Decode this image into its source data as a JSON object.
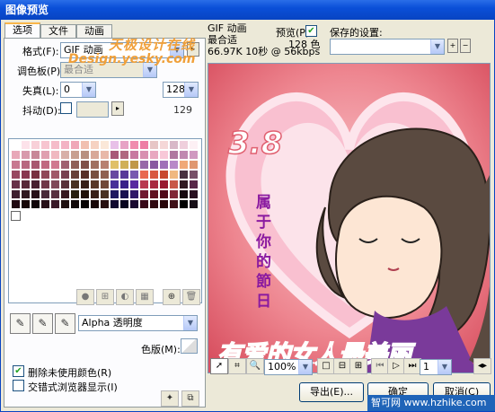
{
  "window": {
    "title": "图像预览"
  },
  "tabs": [
    {
      "label": "选项"
    },
    {
      "label": "文件"
    },
    {
      "label": "动画"
    }
  ],
  "options": {
    "format_label": "格式(F):",
    "format_value": "GIF 动画",
    "palette_label": "调色板(P):",
    "palette_value": "最合适",
    "loss_label": "失真(L):",
    "loss_value": "0",
    "colors_value": "128",
    "colors_count": "129",
    "dither_label": "抖动(D):",
    "transparency_value": "Alpha 透明度",
    "matte_label": "色版(M):",
    "remove_unused_label": "删除未使用颜色(R)",
    "interlace_label": "交错式浏览器显示(I)"
  },
  "info": {
    "format": "GIF 动画",
    "preview_label": "预览(P)",
    "palette": "最合适",
    "colors": "128 色",
    "size_time": "66.97K  10秒 @ 56kbps"
  },
  "saved_settings": {
    "label": "保存的设置:"
  },
  "preview_image": {
    "date_text": "3.8",
    "vertical_text": [
      "属",
      "于",
      "你",
      "的",
      "節",
      "日"
    ],
    "banner_text": "有爱的女人最美丽"
  },
  "toolbar": {
    "zoom": "100%",
    "frame": "1"
  },
  "buttons": {
    "export": "导出(E)...",
    "ok": "确定",
    "cancel": "取消(C)"
  },
  "watermarks": {
    "site_cn": "天极设计在线",
    "site_url": "Design.yesky.com",
    "corner": "智可网 www.hzhike.com"
  },
  "palette_colors": [
    "#ffffff",
    "#fde2ea",
    "#f8d0d8",
    "#f7c5d0",
    "#f5bcc9",
    "#f3b3c4",
    "#f0a8b8",
    "#f1c0b0",
    "#f6d2c2",
    "#fbe8d8",
    "#e8c0e8",
    "#e7a2c5",
    "#f08cae",
    "#ee7ea5",
    "#e7c6c6",
    "#f5d7d7",
    "#d8b8c8",
    "#efcfdc",
    "#fdf0f4",
    "#e8a8b8",
    "#d89aac",
    "#c88898",
    "#e0a0b0",
    "#f0b8c0",
    "#d8b0a8",
    "#c8a090",
    "#b89080",
    "#d8a898",
    "#e8b8a8",
    "#a85878",
    "#b06880",
    "#c878a0",
    "#d890b0",
    "#e8a8c0",
    "#f8c8d8",
    "#b078a0",
    "#c088b0",
    "#d098c0",
    "#c87890",
    "#b86880",
    "#a85870",
    "#c06880",
    "#d07890",
    "#a06070",
    "#906058",
    "#805048",
    "#a07060",
    "#b88070",
    "#e0c068",
    "#d0b058",
    "#c09848",
    "#9868a8",
    "#8858a0",
    "#a070b8",
    "#b888c8",
    "#f0a878",
    "#e09870",
    "#984860",
    "#883850",
    "#783040",
    "#904858",
    "#a05868",
    "#784050",
    "#684038",
    "#583028",
    "#785040",
    "#906050",
    "#6848a0",
    "#583898",
    "#7858b0",
    "#e86850",
    "#d85840",
    "#c84830",
    "#f0b880",
    "#483040",
    "#785068",
    "#683048",
    "#582838",
    "#482030",
    "#703848",
    "#804858",
    "#583038",
    "#483020",
    "#382018",
    "#583828",
    "#704838",
    "#483098",
    "#382088",
    "#5828a0",
    "#b83850",
    "#a82840",
    "#981830",
    "#c85848",
    "#301820",
    "#582848",
    "#402030",
    "#301820",
    "#281018",
    "#482838",
    "#583040",
    "#381820",
    "#282010",
    "#201008",
    "#382018",
    "#483020",
    "#201860",
    "#181050",
    "#301868",
    "#701830",
    "#601020",
    "#500818",
    "#802838",
    "#180810",
    "#281020",
    "#200810",
    "#180808",
    "#100408",
    "#281018",
    "#381828",
    "#201010",
    "#100808",
    "#080404",
    "#180808",
    "#281010",
    "#100830",
    "#080420",
    "#180830",
    "#380818",
    "#300810",
    "#280408",
    "#401018",
    "#000000",
    "#181018"
  ]
}
